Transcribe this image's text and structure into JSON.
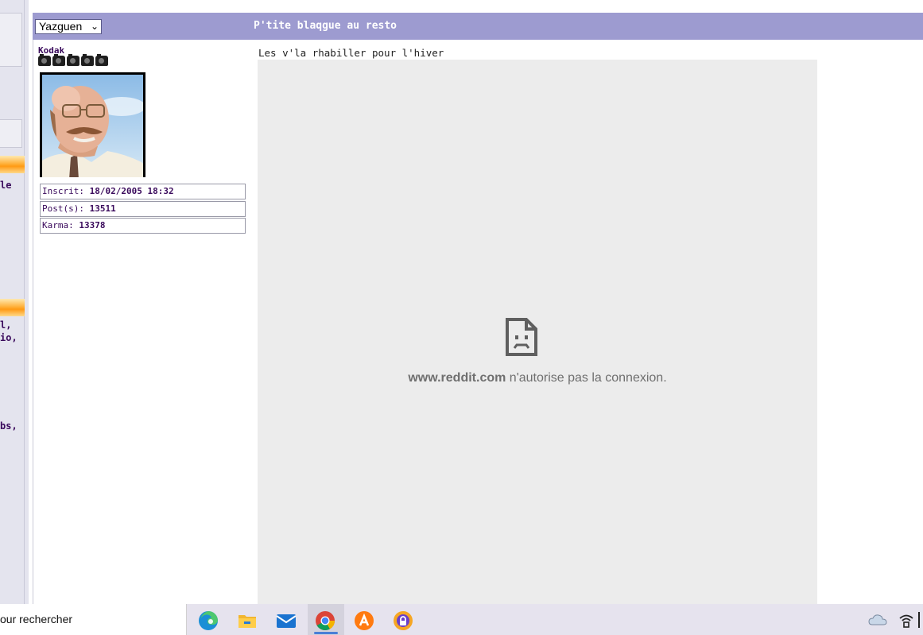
{
  "post": {
    "author_select_value": "Yazguen",
    "title": "P'tite blaqgue au resto",
    "author_name": "Kodak",
    "rank_icon_count": 5,
    "stats": [
      {
        "label": "Inscrit: ",
        "value": "18/02/2005 18:32"
      },
      {
        "label": "Post(s): ",
        "value": "13511"
      },
      {
        "label": "Karma: ",
        "value": "13378"
      }
    ],
    "body_text": "Les v'la rhabiller pour l'hiver",
    "embed": {
      "domain": "www.reddit.com",
      "message": " n'autorise pas la connexion."
    }
  },
  "sidebar_fragments": [
    "le",
    "l,",
    "io,",
    "bs,"
  ],
  "taskbar": {
    "search_text": "our rechercher",
    "apps": [
      "edge-icon",
      "file-explorer-icon",
      "mail-icon",
      "chrome-icon",
      "avast-icon",
      "vpn-shield-icon"
    ],
    "tray": [
      "onedrive-cloud-icon",
      "network-icon"
    ]
  },
  "colors": {
    "header_bg": "#9d9bd0",
    "author_text": "#3a0a5c",
    "embed_bg": "#ececec",
    "sidebar_orange": "#ff9a14"
  }
}
